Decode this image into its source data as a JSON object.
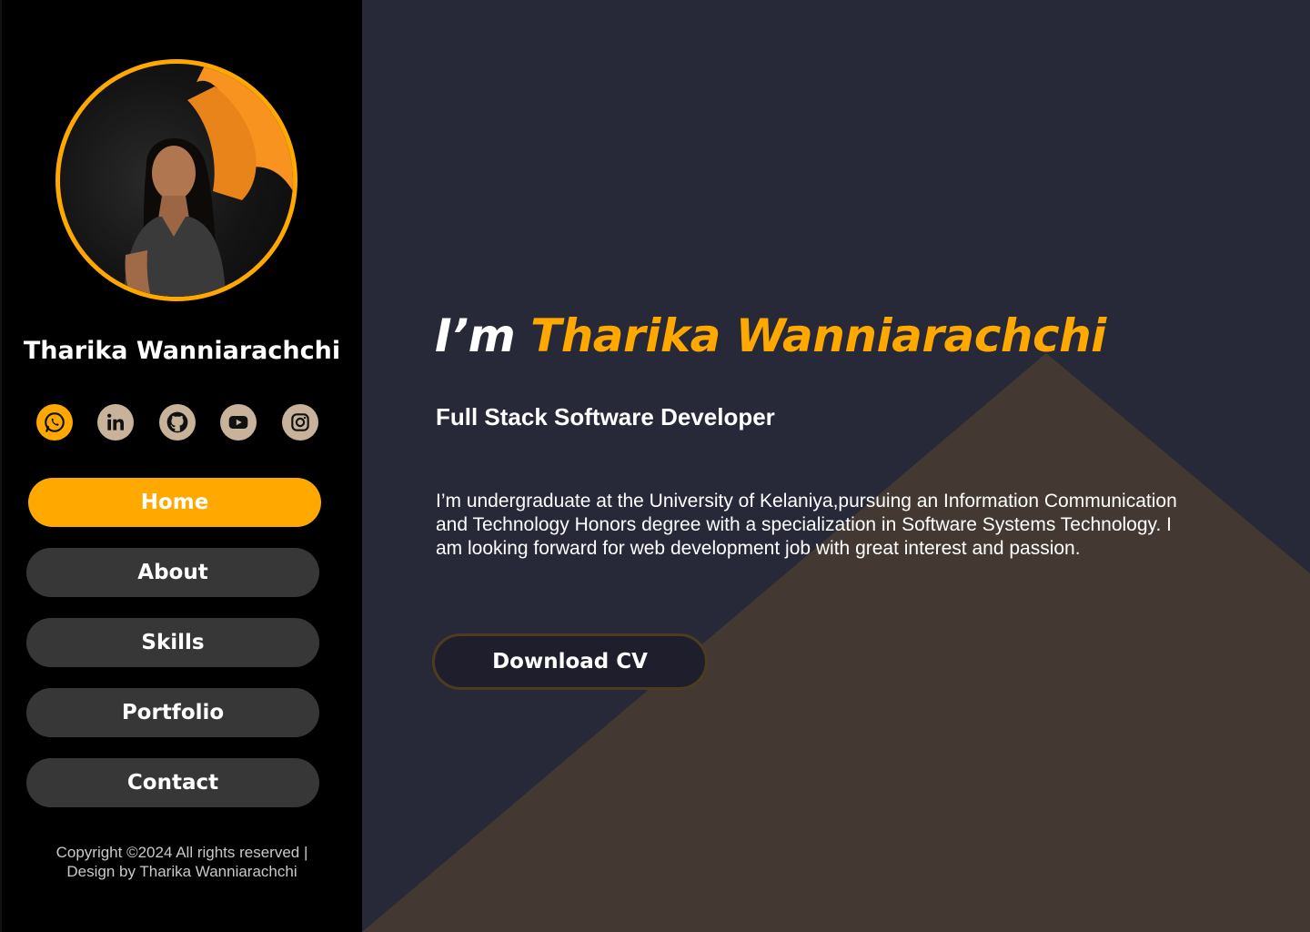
{
  "profile": {
    "name": "Tharika Wanniarachchi",
    "avatar": "profile-photo"
  },
  "socials": [
    {
      "icon": "whatsapp-icon",
      "bg": "#FFA800"
    },
    {
      "icon": "linkedin-icon",
      "bg": "#C8B39A"
    },
    {
      "icon": "github-icon",
      "bg": "#C8B39A"
    },
    {
      "icon": "youtube-icon",
      "bg": "#C8B39A"
    },
    {
      "icon": "instagram-icon",
      "bg": "#C8B39A"
    }
  ],
  "nav": {
    "home": "Home",
    "about": "About",
    "skills": "Skills",
    "portfolio": "Portfolio",
    "contact": "Contact",
    "active": "home"
  },
  "footer": {
    "line1": "Copyright ©2024 All rights reserved |",
    "line2": "Design by Tharika Wanniarachchi"
  },
  "hero": {
    "prefix": "I’m ",
    "name": "Tharika Wanniarachchi",
    "role": "Full Stack Software Developer",
    "bio_line1": "I’m undergraduate at the University of Kelaniya,pursuing an Information Communication",
    "bio_line2": "and Technology Honors degree with a specialization in Software Systems Technology.  I",
    "bio_line3": "am looking forward for web development job with great interest and passion.",
    "cv_button": "Download CV"
  },
  "colors": {
    "accent": "#FFA800",
    "sidebar_bg": "#000000",
    "main_bg": "#272838",
    "triangle": "#433932",
    "nav_inactive": "#373737"
  }
}
